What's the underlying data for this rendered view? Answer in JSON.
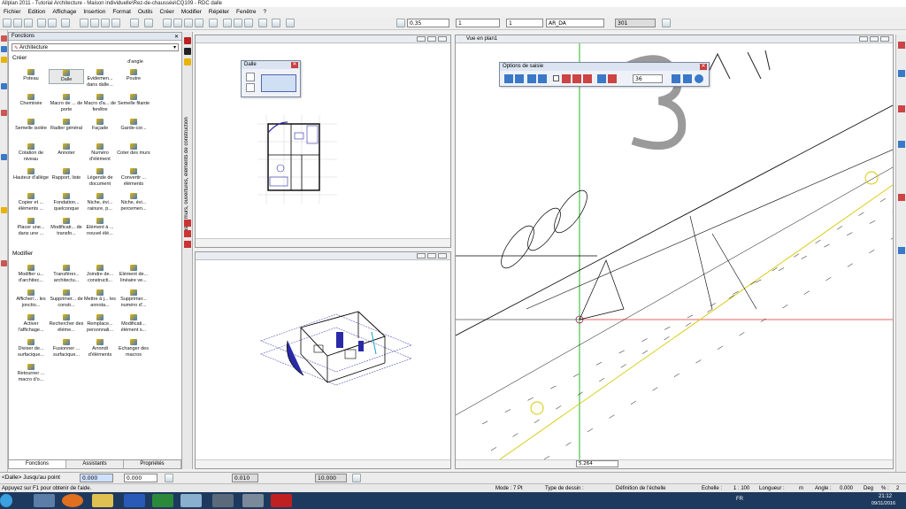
{
  "window": {
    "title": "Allplan 2011 - Tutorial Architecture - Maison individuelle\\Rez-de-chaussée\\CQ109 - RDC dalle"
  },
  "menu": [
    "Fichier",
    "Edition",
    "Affichage",
    "Insertion",
    "Format",
    "Outils",
    "Créer",
    "Modifier",
    "Répéter",
    "Fenêtre",
    "?"
  ],
  "toolbar": {
    "pen_value": "0.35",
    "line_value": "1",
    "color_value": "1",
    "layer_value": "AR_DA",
    "extra_value": "301"
  },
  "functions_panel": {
    "title": "Fonctions",
    "module": "Architecture",
    "section_create": "Créer",
    "d_angle": "d'angle",
    "create_items": [
      "Poteau",
      "Dalle",
      "Evidemen... dans dalle...",
      "Poutre",
      "Cheminée",
      "Macro de ... de porte",
      "Macro d'a... de fenêtre",
      "Semelle filante",
      "Semelle isolée",
      "Radier général",
      "Façade",
      "Garde-cor...",
      "Cotation de niveau",
      "Annoter",
      "Numéro d'élément",
      "Coter des murs",
      "Hauteur d'allège",
      "Rapport, liste",
      "Légende de document",
      "Convertir ... éléments",
      "Copier et ... éléments ...",
      "Fondation... quelconque",
      "Niche, évi... rainure, p...",
      "Niche, évi... percemen...",
      "Placer une... dans une ...",
      "Modificati... de transfo...",
      "Elément à ... nouvel élé..."
    ],
    "section_modify": "Modifier",
    "modify_items": [
      "Modifier u... d'architec...",
      "Transférer... architectu...",
      "Joindre de... constructi...",
      "Elément de... linéaire ve...",
      "Afficher/... les jonctio...",
      "Supprimer... de constr...",
      "Mettre à j... les annota...",
      "Supprimer... numéro d'...",
      "Activer l'affichage...",
      "Rechercher des éléme...",
      "Remplace... personnali...",
      "Modificati... élément s...",
      "Diviser de... surfacique...",
      "Fusionner ... surfacique...",
      "Arrondi d'éléments",
      "Echanger des macros",
      "Retourner ... macro d'o..."
    ],
    "tabs": [
      "Fonctions",
      "Assistants",
      "Propriétés"
    ]
  },
  "side_strip": {
    "label": "Base : murs, ouvertures, éléments de construction"
  },
  "dialogs": {
    "dalle": {
      "title": "Dalle"
    },
    "options": {
      "title": "Options de saisie",
      "value": "36"
    }
  },
  "plan_view": {
    "title": "Vue en plan1",
    "scale_value": "5.264"
  },
  "input_line": {
    "prompt": "<Dalle> Jusqu'au point",
    "value1": "0.000",
    "value2": "0.000",
    "value3": "0.010",
    "value4": "10.000"
  },
  "status": {
    "hint": "Appuyez sur F1 pour obtenir de l'aide.",
    "mode_label": "Mode : 7 Pt",
    "drawing_type_label": "Type de dessin :",
    "scale_def": "Définition de l'échelle",
    "echelle_label": "Echelle :",
    "echelle_value": "1 : 100",
    "longueur_label": "Longueur :",
    "longueur_unit": "m",
    "angle_label": "Angle :",
    "angle_value": "0.000",
    "deg_label": "Deg",
    "pct_label": "% :",
    "pct_value": "2"
  },
  "taskbar": {
    "lang": "FR",
    "time": "21:12",
    "date": "09/11/2016"
  }
}
